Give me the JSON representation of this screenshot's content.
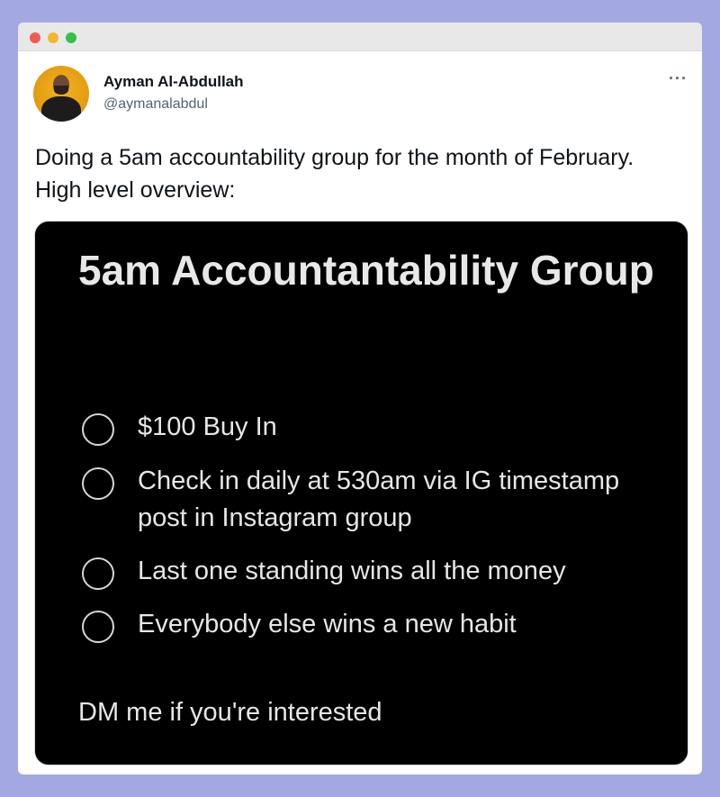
{
  "window": {
    "controls": [
      "close",
      "minimize",
      "maximize"
    ]
  },
  "author": {
    "name": "Ayman Al-Abdullah",
    "handle": "@aymanalabdul",
    "avatar_icon": "profile-photo"
  },
  "more_icon": "···",
  "tweet": {
    "text": "Doing a 5am accountability group for the month of February. High level overview:"
  },
  "card": {
    "title": "5am Accountantability Group",
    "items": [
      {
        "label": "$100 Buy In",
        "checked": false
      },
      {
        "label": "Check in daily at 530am via IG timestamp post in Instagram group",
        "checked": false
      },
      {
        "label": "Last one standing wins all the money",
        "checked": false
      },
      {
        "label": "Everybody else wins a new habit",
        "checked": false
      }
    ],
    "footer": "DM me if you're interested"
  },
  "colors": {
    "background": "#a3a8e2",
    "card_bg": "#000000",
    "text": "#0f1419",
    "secondary_text": "#536471"
  }
}
